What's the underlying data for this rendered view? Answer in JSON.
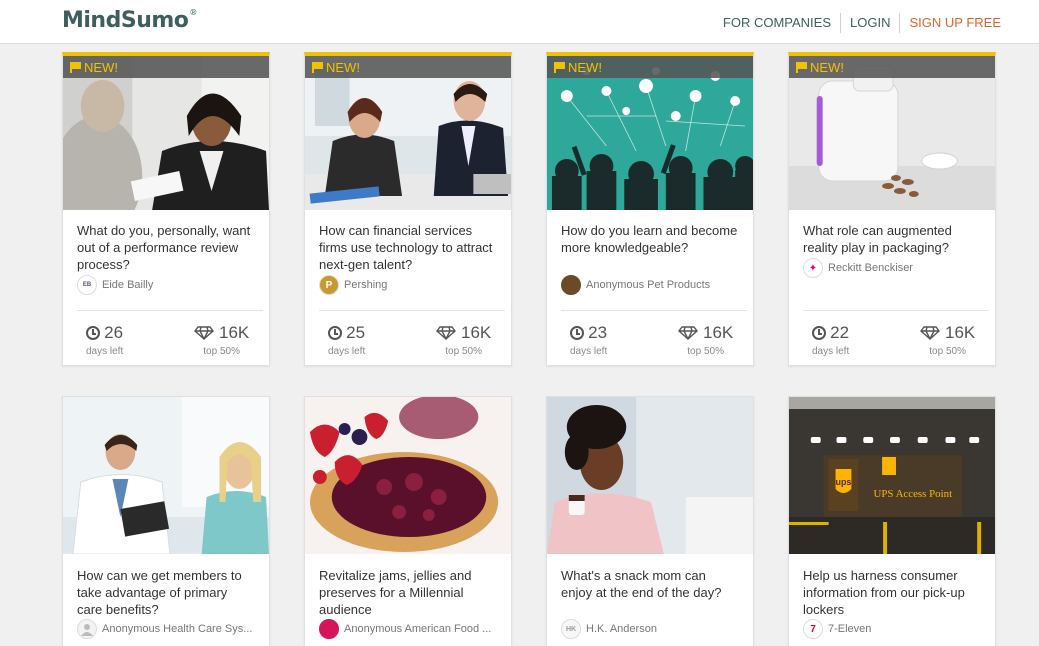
{
  "brand": {
    "name": "MindSumo",
    "reg": "®"
  },
  "nav": {
    "companies": "FOR COMPANIES",
    "login": "LOGIN",
    "signup": "SIGN UP FREE"
  },
  "colors": {
    "accent": "#f2c200",
    "brand": "#3e5f5e",
    "signup": "#e3622a"
  },
  "badge": {
    "new": "NEW!"
  },
  "cards": [
    {
      "title": "What do you, personally, want out of a performance review process?",
      "company": "Eide Bailly",
      "avatar": "eide-bailly-logo",
      "days": "26",
      "days_label": "days left",
      "prize": "16K",
      "prize_label": "top 50%",
      "new": true
    },
    {
      "title": "How can financial services firms use technology to attract next-gen talent?",
      "company": "Pershing",
      "avatar": "pershing-logo",
      "avatar_letter": "P",
      "days": "25",
      "days_label": "days left",
      "prize": "16K",
      "prize_label": "top 50%",
      "new": true
    },
    {
      "title": "How do you learn and become more knowledgeable?",
      "company": "Anonymous Pet Products",
      "avatar": "pet-products-logo",
      "days": "23",
      "days_label": "days left",
      "prize": "16K",
      "prize_label": "top 50%",
      "new": true
    },
    {
      "title": "What role can augmented reality play in packaging?",
      "company": "Reckitt Benckiser",
      "avatar": "reckitt-logo",
      "days": "22",
      "days_label": "days left",
      "prize": "16K",
      "prize_label": "top 50%",
      "new": true
    },
    {
      "title": "How can we get members to take advantage of primary care benefits?",
      "company": "Anonymous Health Care Sys...",
      "avatar": "user-avatar-icon"
    },
    {
      "title": "Revitalize jams, jellies and preserves for a Millennial audience",
      "company": "Anonymous American Food ...",
      "avatar": "food-logo"
    },
    {
      "title": "What's a snack mom can enjoy at the end of the day?",
      "company": "H.K. Anderson",
      "avatar": "hk-anderson-logo"
    },
    {
      "title": "Help us harness consumer information from our pick-up lockers",
      "company": "7-Eleven",
      "avatar": "seven-eleven-logo",
      "avatar_letter": "7"
    }
  ],
  "images": {
    "ups_sign": "UPS Access Point",
    "ups_logo": "ups"
  }
}
